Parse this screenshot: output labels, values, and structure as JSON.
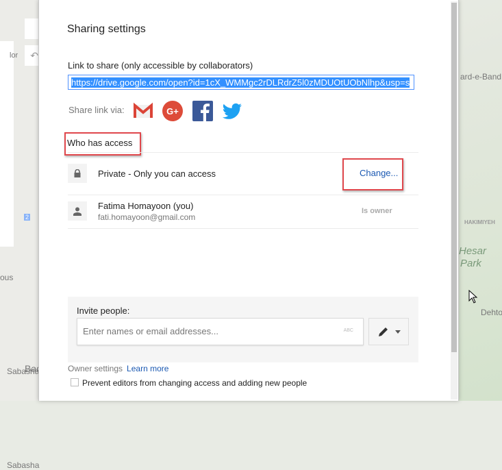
{
  "map": {
    "labels": [
      "lor",
      "ard-e-Band",
      "HAKIMIYEH",
      "Hesar",
      "Park",
      "Dehto",
      "Bad",
      "Sabasha",
      "ous",
      "2"
    ]
  },
  "dialog": {
    "title": "Sharing settings",
    "link_label": "Link to share (only accessible by collaborators)",
    "link_url": "https://drive.google.com/open?id=1cX_WMMgc2rDLRdrZ5l0zMDUOtUObNlhp&usp=s",
    "share_via_label": "Share link via:",
    "share_icons": [
      "gmail-icon",
      "google-plus-icon",
      "facebook-icon",
      "twitter-icon"
    ],
    "who_has_access": "Who has access",
    "access": {
      "text": "Private - Only you can access",
      "change_label": "Change..."
    },
    "owner": {
      "name": "Fatima Homayoon (you)",
      "email": "fati.homayoon@gmail.com",
      "role": "Is owner"
    },
    "invite": {
      "label": "Invite people:",
      "placeholder": "Enter names or email addresses...",
      "value": "",
      "spellcheck_badge": "ABC"
    },
    "owner_settings_label": "Owner settings",
    "learn_more": "Learn more",
    "prevent_label": "Prevent editors from changing access and adding new people",
    "prevent_checked": false
  },
  "colors": {
    "highlight": "#e0474c",
    "link": "#1a58b2",
    "selection": "#3390ff"
  }
}
